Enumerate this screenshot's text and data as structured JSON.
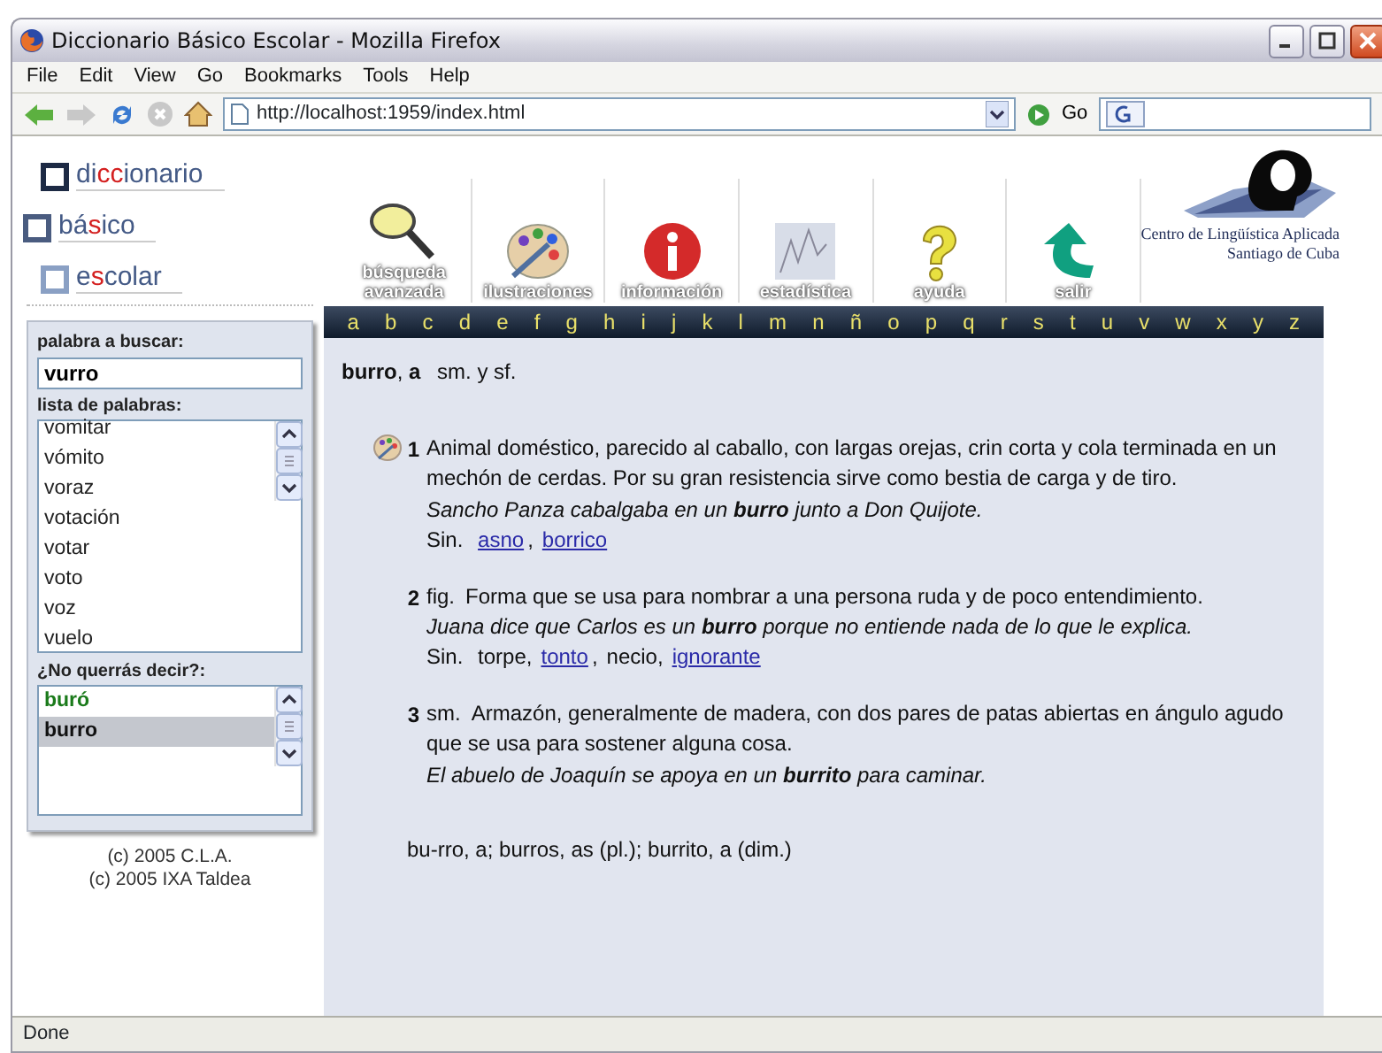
{
  "window": {
    "title": "Diccionario Básico Escolar - Mozilla Firefox"
  },
  "menu": [
    "File",
    "Edit",
    "View",
    "Go",
    "Bookmarks",
    "Tools",
    "Help"
  ],
  "address": {
    "url": "http://localhost:1959/index.html",
    "go": "Go"
  },
  "logo": [
    {
      "segments": [
        {
          "text": "di",
          "highlight": false
        },
        {
          "text": "cc",
          "highlight": true
        },
        {
          "text": "ionario",
          "highlight": false
        }
      ]
    },
    {
      "segments": [
        {
          "text": "bá",
          "highlight": false
        },
        {
          "text": "s",
          "highlight": true
        },
        {
          "text": "ico",
          "highlight": false
        }
      ]
    },
    {
      "segments": [
        {
          "text": "e",
          "highlight": false
        },
        {
          "text": "s",
          "highlight": true
        },
        {
          "text": "colar",
          "highlight": false
        }
      ]
    }
  ],
  "tools": [
    {
      "kind": "search",
      "label": "búsqueda\navanzada"
    },
    {
      "kind": "palette",
      "label": "ilustraciones"
    },
    {
      "kind": "info",
      "label": "información"
    },
    {
      "kind": "chart",
      "label": "estadística"
    },
    {
      "kind": "help",
      "label": "ayuda"
    },
    {
      "kind": "exit",
      "label": "salir"
    }
  ],
  "organization": [
    "Centro de Lingüística Aplicada",
    "Santiago de Cuba"
  ],
  "alphabet": [
    "a",
    "b",
    "c",
    "d",
    "e",
    "f",
    "g",
    "h",
    "i",
    "j",
    "k",
    "l",
    "m",
    "n",
    "ñ",
    "o",
    "p",
    "q",
    "r",
    "s",
    "t",
    "u",
    "v",
    "w",
    "x",
    "y",
    "z"
  ],
  "sidebar": {
    "search_label": "palabra a buscar:",
    "search_value": "vurro",
    "list_label": "lista de palabras:",
    "words": [
      "vomitar",
      "vómito",
      "voraz",
      "votación",
      "votar",
      "voto",
      "voz",
      "vuelo"
    ],
    "suggest_label": "¿No querrás decir?:",
    "suggestions": [
      {
        "text": "buró",
        "selected": false,
        "color": "#1a7a1a"
      },
      {
        "text": "burro",
        "selected": true,
        "color": "#111111"
      }
    ],
    "copyright": [
      "(c) 2005 C.L.A.",
      "(c) 2005 IXA Taldea"
    ]
  },
  "entry": {
    "headword": "**burro**, **a**",
    "grammar": "sm. y sf.",
    "senses": [
      {
        "number": "1",
        "illustrated": true,
        "definition": "Animal doméstico, parecido al caballo, con largas orejas, crin corta y cola terminada en un mechón de cerdas. Por su gran resistencia sirve como bestia de carga y de tiro.",
        "example": "Sancho Panza cabalgaba en un **burro** junto a Don Quijote.",
        "synonyms_label": "Sin.",
        "synonyms": [
          {
            "text": "asno",
            "link": true,
            "separator": ","
          },
          {
            "text": "borrico",
            "link": true
          }
        ]
      },
      {
        "number": "2",
        "illustrated": false,
        "label": "fig.",
        "definition": "Forma que se usa para nombrar a una persona ruda y de poco entendimiento.",
        "example": "Juana dice que Carlos es un **burro** porque no entiende nada de lo que le explica.",
        "synonyms_label": "Sin.",
        "synonyms": [
          {
            "text": "torpe",
            "link": false,
            "separator": ","
          },
          {
            "text": "tonto",
            "link": true,
            "separator": ","
          },
          {
            "text": "necio",
            "link": false,
            "separator": ","
          },
          {
            "text": "ignorante",
            "link": true
          }
        ]
      },
      {
        "number": "3",
        "illustrated": false,
        "label": "sm.",
        "definition": "Armazón, generalmente de madera, con dos pares de patas abiertas en ángulo agudo que se usa para sostener alguna cosa.",
        "example": "El abuelo de Joaquín se apoya en un **burrito** para caminar."
      }
    ],
    "forms": "bu-rro, a; burros, as (pl.); burrito, a (dim.)"
  },
  "status_bar": "Done"
}
